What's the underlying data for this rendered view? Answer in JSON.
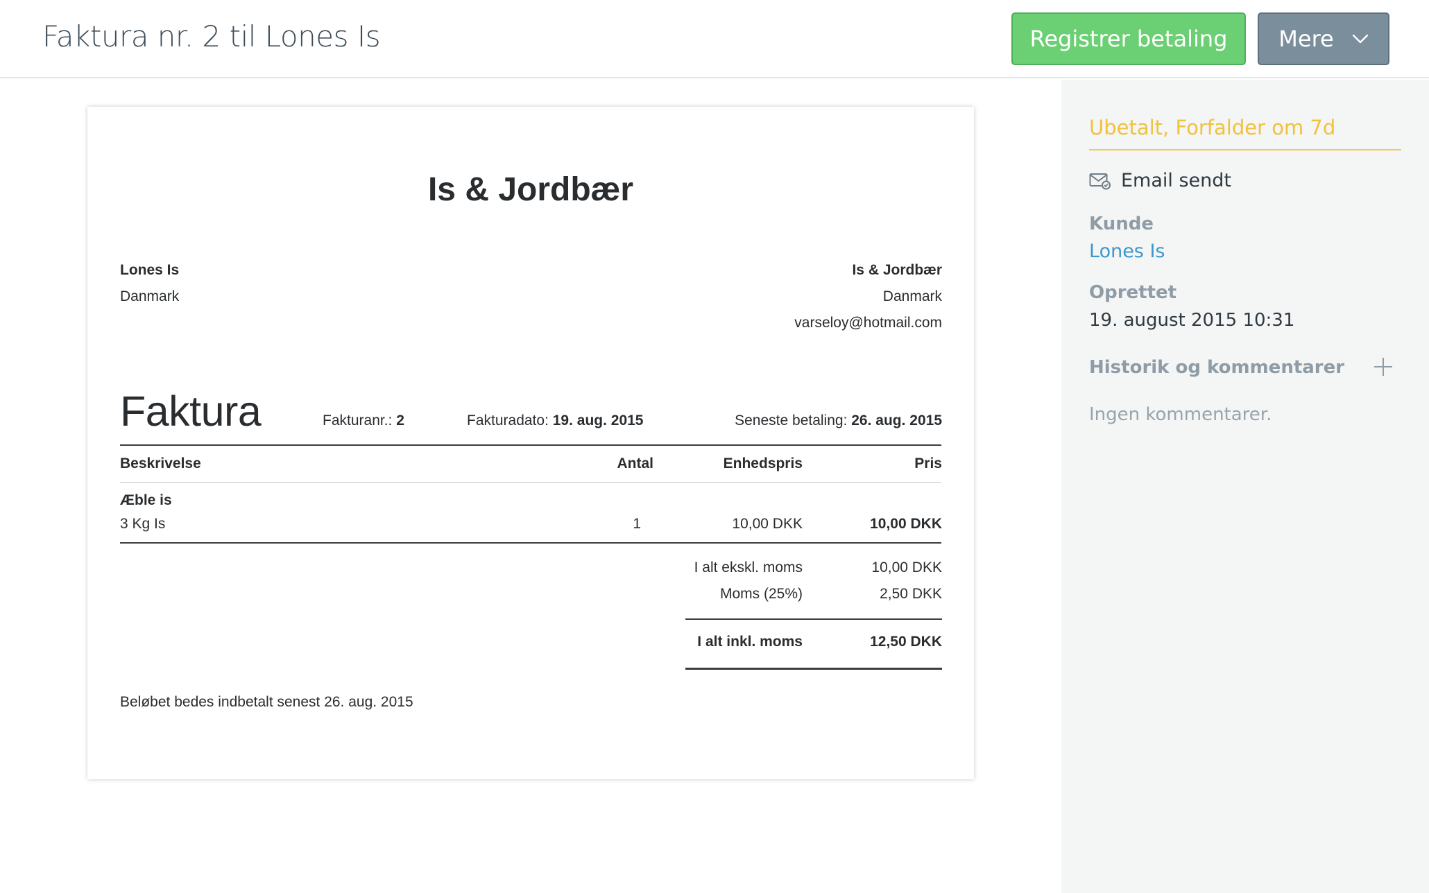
{
  "header": {
    "title": "Faktura nr. 2 til Lones Is",
    "register_payment_label": "Registrer betaling",
    "more_label": "Mere"
  },
  "sidebar": {
    "status": "Ubetalt, Forfalder om 7d",
    "email_status": "Email sendt",
    "customer_label": "Kunde",
    "customer_name": "Lones Is",
    "created_label": "Oprettet",
    "created_value": "19. august 2015 10:31",
    "history_label": "Historik og kommentarer",
    "no_comments": "Ingen kommentarer."
  },
  "invoice": {
    "company_heading": "Is & Jordbær",
    "recipient": {
      "name": "Lones Is",
      "country": "Danmark"
    },
    "sender": {
      "name": "Is & Jordbær",
      "country": "Danmark",
      "email": "varseloy@hotmail.com"
    },
    "title": "Faktura",
    "number_label": "Fakturanr.: ",
    "number_value": "2",
    "date_label": "Fakturadato: ",
    "date_value": "19. aug. 2015",
    "due_label": "Seneste betaling: ",
    "due_value": "26. aug. 2015",
    "columns": {
      "description": "Beskrivelse",
      "quantity": "Antal",
      "unit_price": "Enhedspris",
      "price": "Pris"
    },
    "line_items": [
      {
        "name": "Æble is",
        "description": "3 Kg Is",
        "quantity": "1",
        "unit_price": "10,00 DKK",
        "price": "10,00 DKK"
      }
    ],
    "totals": {
      "excl_label": "I alt ekskl. moms",
      "excl_value": "10,00 DKK",
      "vat_label": "Moms (25%)",
      "vat_value": "2,50 DKK",
      "incl_label": "I alt inkl. moms",
      "incl_value": "12,50 DKK"
    },
    "footer_note": "Beløbet bedes indbetalt senest 26. aug. 2015"
  },
  "colors": {
    "primary_button": "#6bcf74",
    "secondary_button": "#7b8e9c",
    "status_warning": "#f0c23e",
    "link": "#3c97d0"
  },
  "icons": [
    "envelope-icon",
    "chevron-down-icon",
    "plus-icon"
  ]
}
